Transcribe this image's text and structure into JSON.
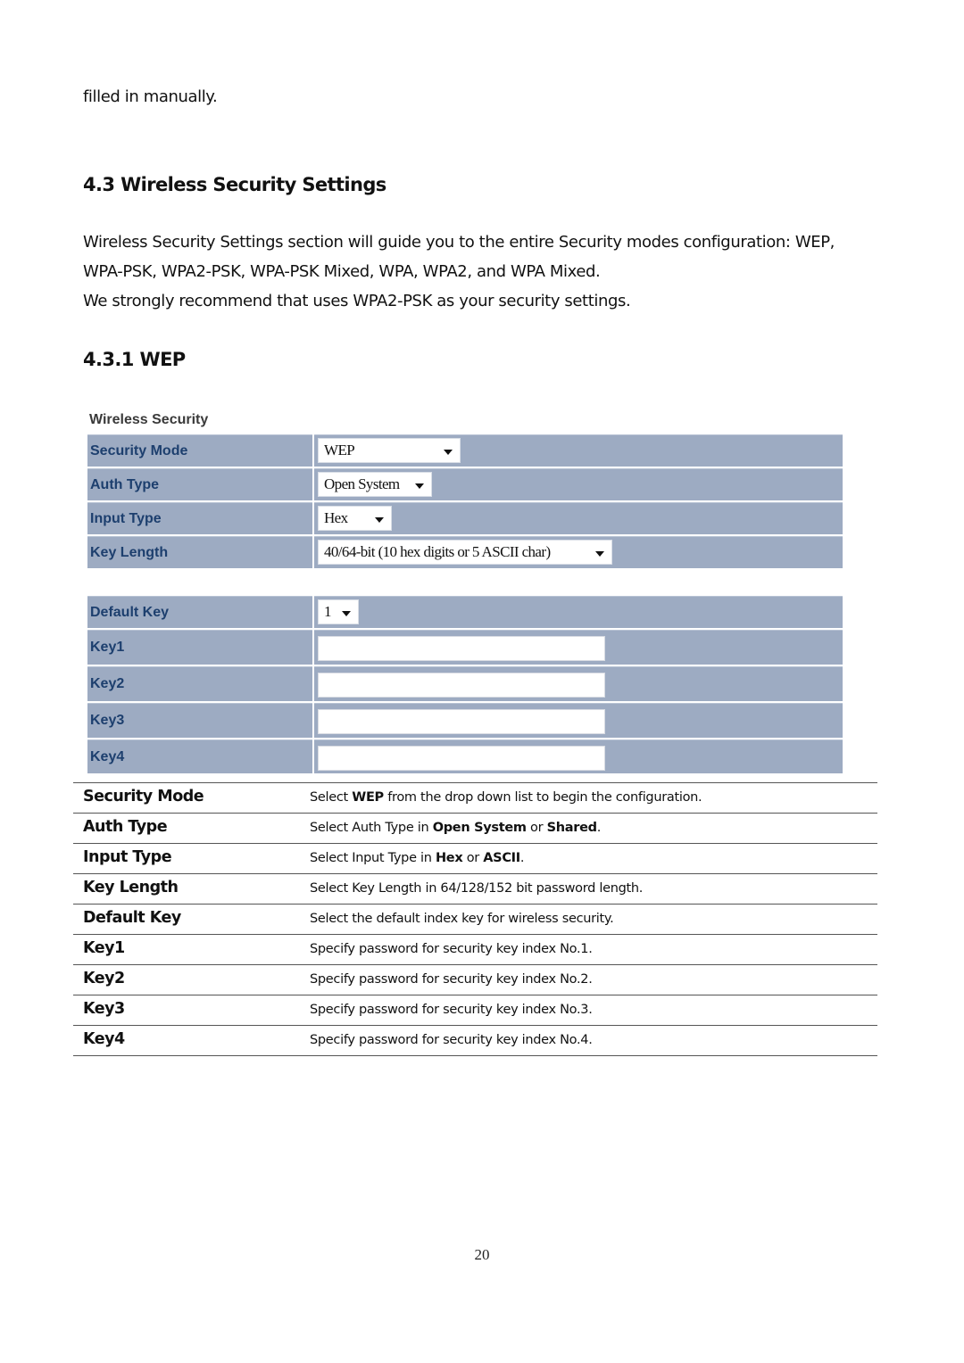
{
  "intro_fragment": "filled in manually.",
  "section": {
    "heading": "4.3 Wireless Security Settings",
    "paragraph_lines": [
      "Wireless Security Settings section will guide you to the entire Security modes configuration: WEP,",
      "WPA-PSK, WPA2-PSK, WPA-PSK Mixed, WPA, WPA2, and WPA Mixed.",
      "We strongly recommend that uses WPA2-PSK as your security settings."
    ]
  },
  "subsection": {
    "heading": "4.3.1 WEP"
  },
  "screenshot": {
    "title": "Wireless Security",
    "colors": {
      "row_bg": "#9dabc2",
      "label_text": "#1d3f6e"
    },
    "group1": [
      {
        "label": "Security Mode",
        "type": "select",
        "value": "WEP"
      },
      {
        "label": "Auth Type",
        "type": "select",
        "value": "Open System"
      },
      {
        "label": "Input Type",
        "type": "select",
        "value": "Hex"
      },
      {
        "label": "Key Length",
        "type": "select",
        "value": "40/64-bit (10 hex digits or 5 ASCII char)"
      }
    ],
    "group2": [
      {
        "label": "Default Key",
        "type": "select",
        "value": "1"
      },
      {
        "label": "Key1",
        "type": "text",
        "value": ""
      },
      {
        "label": "Key2",
        "type": "text",
        "value": ""
      },
      {
        "label": "Key3",
        "type": "text",
        "value": ""
      },
      {
        "label": "Key4",
        "type": "text",
        "value": ""
      }
    ]
  },
  "description_table": [
    {
      "name": "Security Mode",
      "desc": [
        {
          "t": "Select "
        },
        {
          "t": "WEP",
          "b": true
        },
        {
          "t": " from the drop down list to begin the configuration."
        }
      ]
    },
    {
      "name": "Auth Type",
      "desc": [
        {
          "t": "Select Auth Type in "
        },
        {
          "t": "Open System",
          "b": true
        },
        {
          "t": " or "
        },
        {
          "t": "Shared",
          "b": true
        },
        {
          "t": "."
        }
      ]
    },
    {
      "name": "Input Type",
      "desc": [
        {
          "t": "Select Input Type in "
        },
        {
          "t": "Hex",
          "b": true
        },
        {
          "t": " or "
        },
        {
          "t": "ASCII",
          "b": true
        },
        {
          "t": "."
        }
      ]
    },
    {
      "name": "Key Length",
      "desc": [
        {
          "t": "Select Key Length in 64/128/152 bit password length."
        }
      ]
    },
    {
      "name": "Default Key",
      "desc": [
        {
          "t": "Select the default index key for wireless security."
        }
      ]
    },
    {
      "name": "Key1",
      "desc": [
        {
          "t": "Specify password for security key index No.1."
        }
      ]
    },
    {
      "name": "Key2",
      "desc": [
        {
          "t": "Specify password for security key index No.2."
        }
      ]
    },
    {
      "name": "Key3",
      "desc": [
        {
          "t": "Specify password for security key index No.3."
        }
      ]
    },
    {
      "name": "Key4",
      "desc": [
        {
          "t": "Specify password for security key index No.4."
        }
      ]
    }
  ],
  "page_number": "20"
}
